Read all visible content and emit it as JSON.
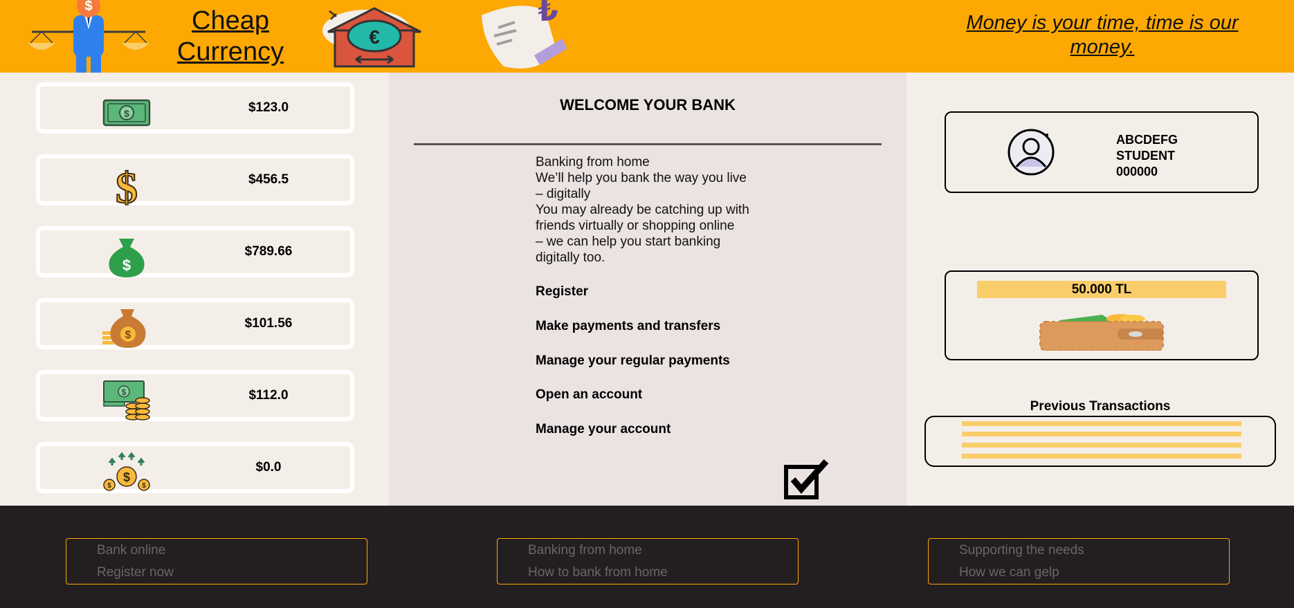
{
  "header": {
    "brand_line1": "Cheap",
    "brand_line2": "Currency",
    "slogan": "Money is your time, time is our money."
  },
  "money_cards": [
    {
      "icon": "cash-bill-icon",
      "amount": "$123.0"
    },
    {
      "icon": "dollar-sign-icon",
      "amount": "$456.5"
    },
    {
      "icon": "money-bag-icon",
      "amount": "$789.66"
    },
    {
      "icon": "money-sack-coins-icon",
      "amount": "$101.56"
    },
    {
      "icon": "cash-coins-stack-icon",
      "amount": "$112.0"
    },
    {
      "icon": "coin-growth-icon",
      "amount": "$0.0"
    }
  ],
  "main": {
    "welcome": "WELCOME YOUR BANK",
    "intro_lines": [
      "Banking from home",
      "We’ll help you bank the way you live",
      "– digitally",
      "You may already be catching up with",
      "friends virtually or shopping online",
      "– we can help you start banking",
      "digitally too."
    ],
    "links": [
      "Register",
      "Make payments and transfers",
      "Manage your regular payments",
      "Open an account",
      "Manage your account"
    ]
  },
  "profile": {
    "name": "ABCDEFG",
    "role": "STUDENT",
    "number": "000000"
  },
  "wallet": {
    "balance": "50.000 TL"
  },
  "transactions": {
    "title": "Previous Transactions",
    "line_count_visible": 4
  },
  "footer": {
    "boxes": [
      {
        "line1": "Bank online",
        "line2": "Register now"
      },
      {
        "line1": "Banking from home",
        "line2": "How to bank from home"
      },
      {
        "line1": "Supporting the needs",
        "line2": "How we can gelp"
      }
    ]
  },
  "colors": {
    "header_orange": "#fea803",
    "accent_yellow": "#f9cd69",
    "footer_dark": "#231f20",
    "panel_beige": "#f4eee9",
    "panel_mid": "#ebe2e2"
  }
}
